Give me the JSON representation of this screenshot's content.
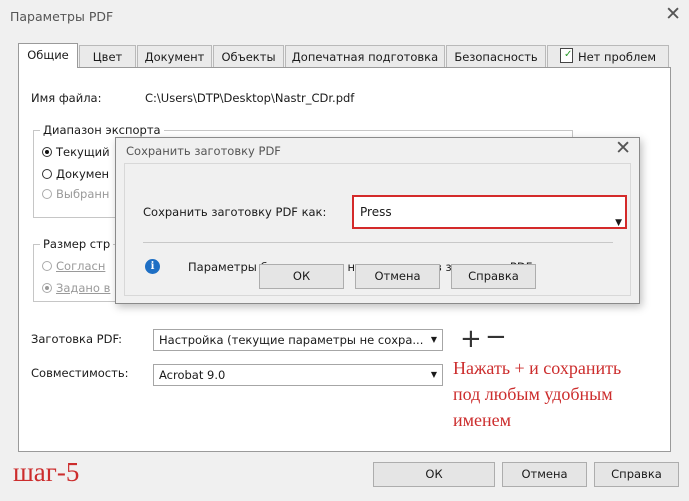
{
  "window": {
    "title": "Параметры PDF"
  },
  "tabs": [
    {
      "label": "Общие"
    },
    {
      "label": "Цвет"
    },
    {
      "label": "Документ"
    },
    {
      "label": "Объекты"
    },
    {
      "label": "Допечатная подготовка"
    },
    {
      "label": "Безопасность"
    },
    {
      "label": "Нет проблем"
    }
  ],
  "general": {
    "filename_label": "Имя файла:",
    "filename_value": "C:\\Users\\DTP\\Desktop\\Nastr_CDr.pdf",
    "export_range_legend": "Диапазон экспорта",
    "export_options": [
      "Текущий",
      "Докумен",
      "Выбранн"
    ],
    "page_size_legend": "Размер стр",
    "page_size_options": [
      "Согласн",
      "Задано в"
    ],
    "preset_label": "Заготовка PDF:",
    "preset_value": "Настройка (текущие параметры не сохра...",
    "compat_label": "Совместимость:",
    "compat_value": "Acrobat 9.0"
  },
  "dialog": {
    "title": "Сохранить заготовку PDF",
    "save_as_label": "Сохранить заготовку PDF как:",
    "save_as_value": "Press",
    "info_text": "Параметры безопасности не сохранены в заготовке PDF",
    "ok_label": "ОК",
    "cancel_label": "Отмена",
    "help_label": "Справка"
  },
  "buttons": {
    "ok_label": "ОК",
    "cancel_label": "Отмена",
    "help_label": "Справка"
  },
  "annotation": {
    "instruction_lines": [
      "Нажать + и сохранить",
      "под любым удобным",
      "именем"
    ],
    "step_label": "шаг-5",
    "color": "#cc2d2d"
  }
}
